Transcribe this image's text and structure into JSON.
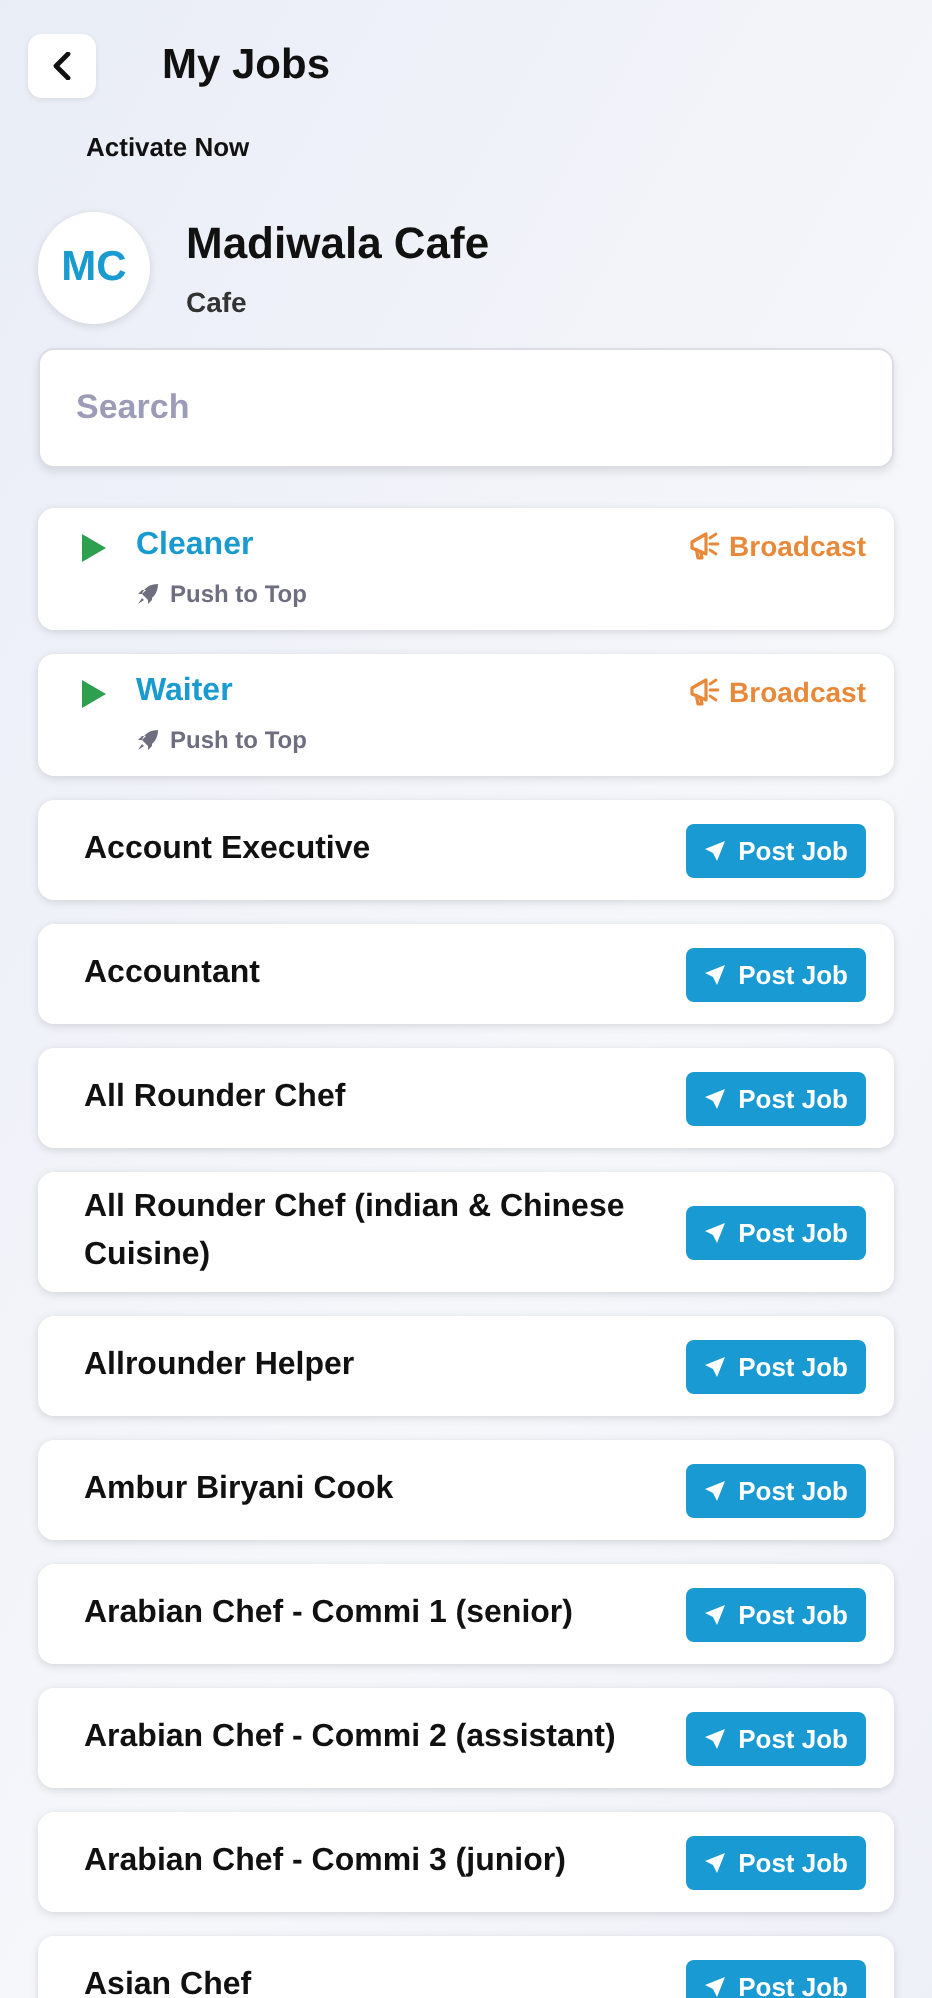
{
  "header": {
    "title": "My Jobs",
    "subtitle": "Activate Now"
  },
  "business": {
    "initials": "MC",
    "name": "Madiwala Cafe",
    "category": "Cafe"
  },
  "search": {
    "placeholder": "Search"
  },
  "active_jobs": [
    {
      "title": "Cleaner",
      "push_label": "Push to Top",
      "action": "Broadcast"
    },
    {
      "title": "Waiter",
      "push_label": "Push to Top",
      "action": "Broadcast"
    }
  ],
  "job_templates": [
    {
      "title": "Account Executive",
      "action": "Post Job"
    },
    {
      "title": "Accountant",
      "action": "Post Job"
    },
    {
      "title": "All Rounder Chef",
      "action": "Post Job"
    },
    {
      "title": "All Rounder Chef (indian & Chinese Cuisine)",
      "action": "Post Job"
    },
    {
      "title": "Allrounder Helper",
      "action": "Post Job"
    },
    {
      "title": "Ambur Biryani Cook",
      "action": "Post Job"
    },
    {
      "title": "Arabian Chef - Commi 1 (senior)",
      "action": "Post Job"
    },
    {
      "title": "Arabian Chef - Commi 2 (assistant)",
      "action": "Post Job"
    },
    {
      "title": "Arabian Chef - Commi 3 (junior)",
      "action": "Post Job"
    },
    {
      "title": "Asian Chef",
      "action": "Post Job"
    }
  ]
}
